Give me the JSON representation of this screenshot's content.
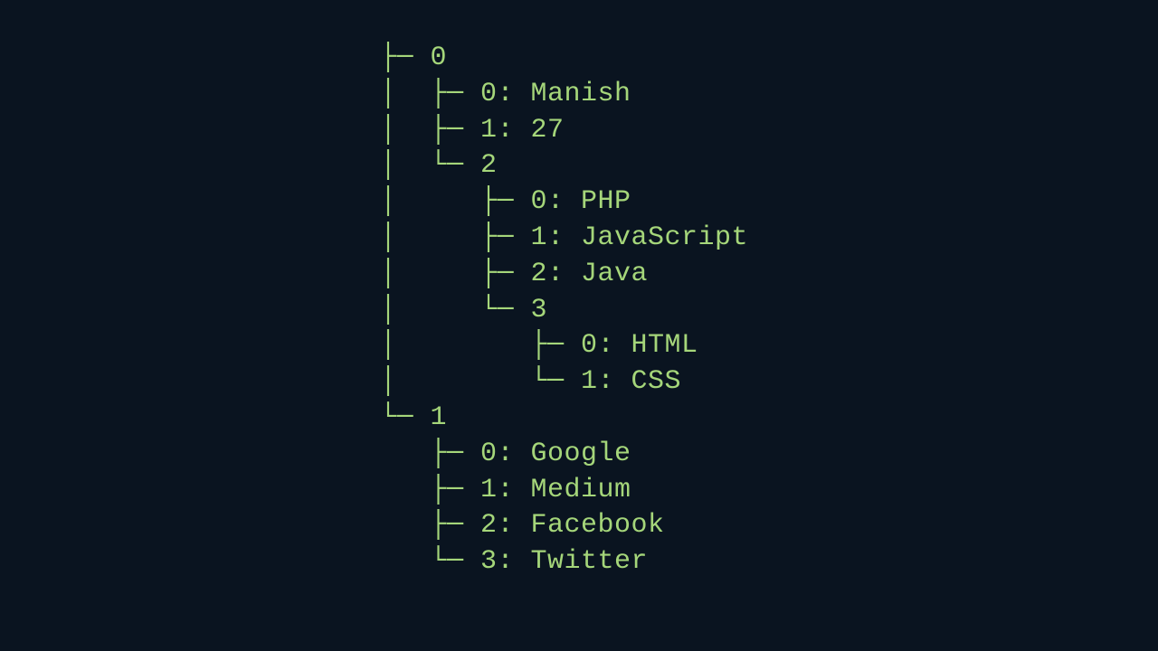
{
  "tree": {
    "lines": [
      "├─ 0",
      "│  ├─ 0: Manish",
      "│  ├─ 1: 27",
      "│  └─ 2",
      "│     ├─ 0: PHP",
      "│     ├─ 1: JavaScript",
      "│     ├─ 2: Java",
      "│     └─ 3",
      "│        ├─ 0: HTML",
      "│        └─ 1: CSS",
      "└─ 1",
      "   ├─ 0: Google",
      "   ├─ 1: Medium",
      "   ├─ 2: Facebook",
      "   └─ 3: Twitter"
    ]
  },
  "colors": {
    "background": "#0a1420",
    "foreground": "#a5d67a"
  }
}
